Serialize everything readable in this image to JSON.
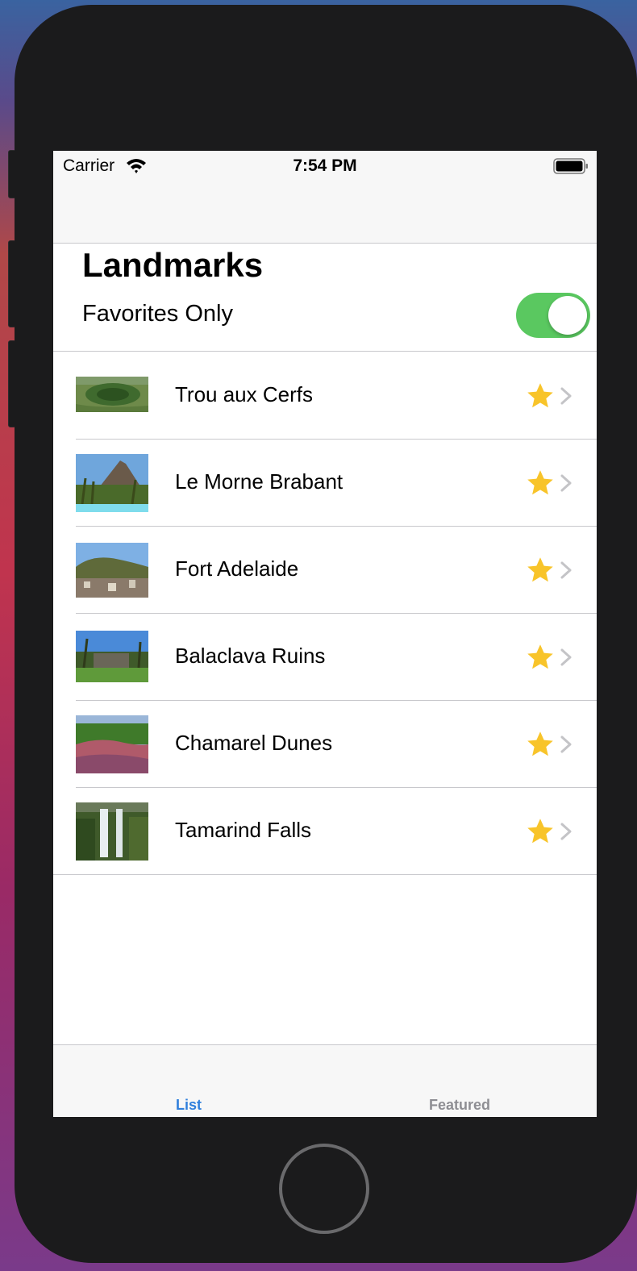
{
  "status_bar": {
    "carrier": "Carrier",
    "time": "7:54 PM",
    "wifi_icon": "wifi-icon",
    "battery_icon": "battery-full-icon"
  },
  "header": {
    "title": "Landmarks",
    "favorites_label": "Favorites Only",
    "favorites_toggle_on": true
  },
  "landmarks": [
    {
      "name": "Trou aux Cerfs",
      "favorite": true
    },
    {
      "name": "Le Morne Brabant",
      "favorite": true
    },
    {
      "name": "Fort Adelaide",
      "favorite": true
    },
    {
      "name": "Balaclava Ruins",
      "favorite": true
    },
    {
      "name": "Chamarel Dunes",
      "favorite": true
    },
    {
      "name": "Tamarind Falls",
      "favorite": true
    }
  ],
  "tab_bar": {
    "tabs": [
      {
        "label": "List",
        "selected": true
      },
      {
        "label": "Featured",
        "selected": false
      }
    ]
  },
  "colors": {
    "accent": "#2f7fdc",
    "toggle_on": "#5ac860",
    "star": "#f8c42a",
    "separator": "#c8c8cc"
  }
}
